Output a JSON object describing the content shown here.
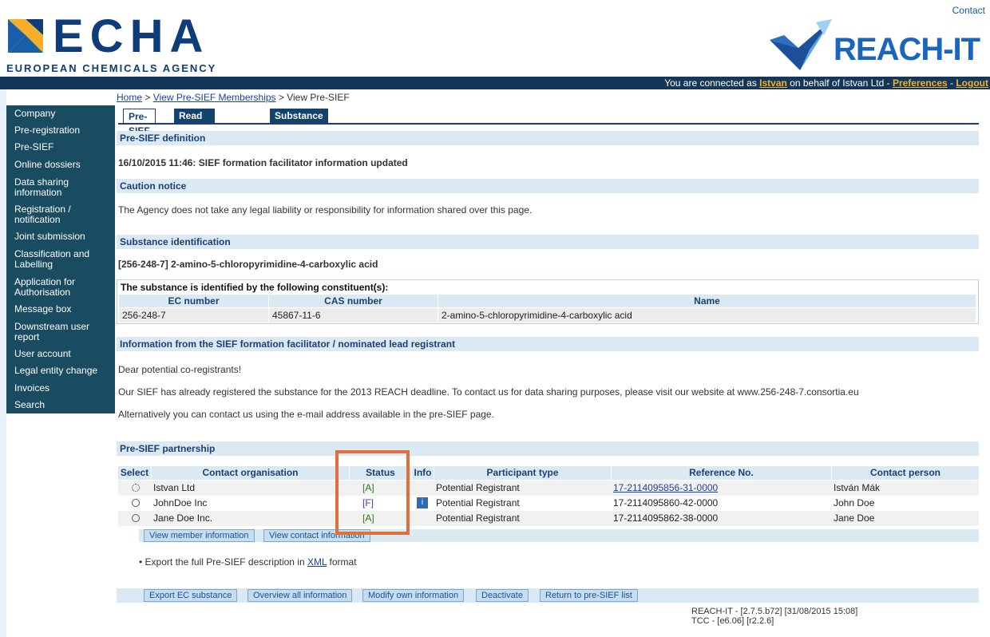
{
  "header": {
    "contact": "Contact",
    "echa_word": "ECHA",
    "echa_subtitle": "EUROPEAN CHEMICALS AGENCY",
    "reach_word": "REACH-IT"
  },
  "topbar": {
    "prefix": "You are connected as ",
    "user": "Istvan",
    "middle": " on behalf of Istvan Ltd - ",
    "preferences": "Preferences",
    "sep": " - ",
    "logout": "Logout"
  },
  "sidebar": {
    "items": [
      "Company",
      "Pre-registration",
      "Pre-SIEF",
      "Online dossiers",
      "Data sharing information",
      "Registration / notification",
      "Joint submission",
      "Classification and Labelling",
      "Application for Authorisation",
      "Message box",
      "Downstream user report",
      "User account",
      "Legal entity change",
      "Invoices",
      "Search"
    ]
  },
  "breadcrumb": {
    "home": "Home",
    "sep": " > ",
    "memberships": "View Pre-SIEF Memberships",
    "current": "View Pre-SIEF"
  },
  "tabs": [
    "Pre-SIEF",
    "Read across details",
    "Substance details"
  ],
  "sections": {
    "definition": "Pre-SIEF definition",
    "caution": "Caution notice",
    "identification": "Substance identification",
    "facilitator": "Information from the SIEF formation facilitator / nominated lead registrant",
    "partnership": "Pre-SIEF partnership"
  },
  "definition_text": "16/10/2015 11:46: SIEF formation facilitator information updated",
  "caution_text": "The Agency does not take any legal liability or responsibility for information shared over this page.",
  "substance_title": "[256-248-7] 2-amino-5-chloropyrimidine-4-carboxylic acid",
  "constituents": {
    "heading": "The substance is identified by the following constituent(s):",
    "columns": [
      "EC number",
      "CAS number",
      "Name"
    ],
    "row": [
      "256-248-7",
      "45867-11-6",
      "2-amino-5-chloropyrimidine-4-carboxylic acid"
    ]
  },
  "facilitator_text": [
    "Dear potential co-registrants!",
    "Our SIEF has already registered the substance for the 2013 REACH deadline. To contact us for data sharing purposes, please visit our website at www.256-248-7.consortia.eu",
    "Alternatively you can contact us using the e-mail address available in the pre-SIEF page."
  ],
  "partnership": {
    "columns": [
      "Select",
      "Contact organisation",
      "Status",
      "Info",
      "Participant type",
      "Reference No.",
      "Contact person"
    ],
    "rows": [
      {
        "org": "Istvan Ltd",
        "status": "[A]",
        "type": "Potential Registrant",
        "ref": "17-2114095856-31-0000",
        "person": "István Mák"
      },
      {
        "org": "JohnDoe Inc",
        "status": "[F]",
        "type": "Potential Registrant",
        "ref": "17-2114095860-42-0000",
        "person": "John Doe"
      },
      {
        "org": "Jane Doe Inc.",
        "status": "[A]",
        "type": "Potential Registrant",
        "ref": "17-2114095862-38-0000",
        "person": "Jane Doe"
      }
    ],
    "buttons": [
      "View member information",
      "View contact information"
    ]
  },
  "export": {
    "prefix": "Export the full Pre-SIEF description in ",
    "link": "XML",
    "suffix": " format"
  },
  "actions": [
    "Export EC substance",
    "Overview all information",
    "Modify own information",
    "Deactivate",
    "Return to pre-SIEF list"
  ],
  "version": {
    "line1": "REACH-IT - [2.7.5.b72] [31/08/2015 15:08]",
    "line2": "TCC - [e6.06] [r2.2.6]"
  }
}
